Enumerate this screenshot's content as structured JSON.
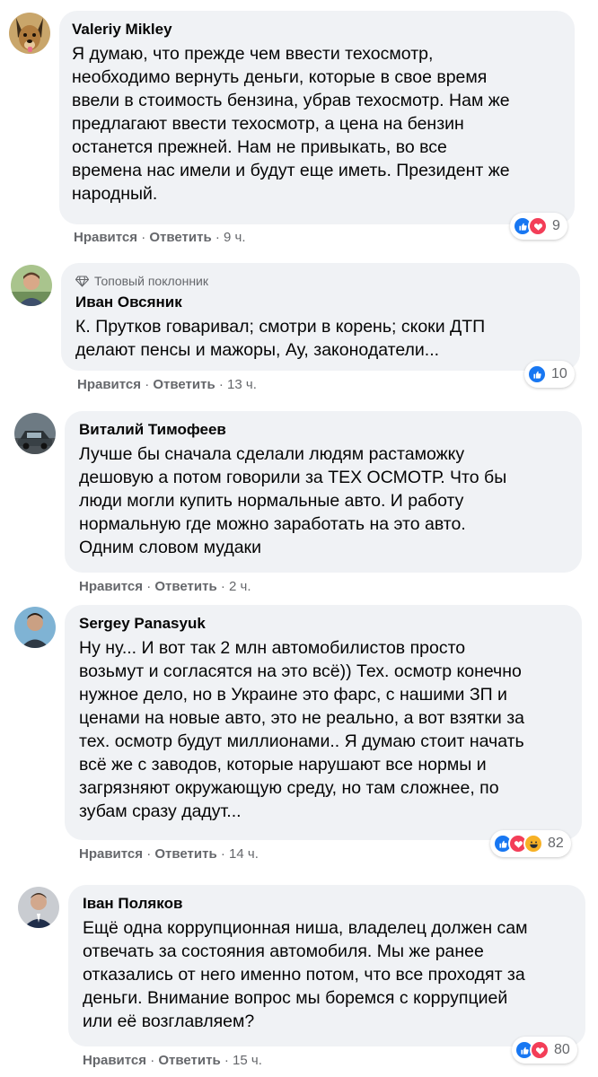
{
  "comments": [
    {
      "author": "Valeriy Mikley",
      "text": "Я думаю, что прежде чем ввести техосмотр,\nнеобходимо вернуть деньги, которые в свое время\nввели в стоимость бензина, убрав техосмотр. Нам же\nпредлагают ввести техосмотр, а цена на бензин\nостанется прежней. Нам не привыкать, во все\nвремена нас имели и будут еще иметь. Президент же\nнародный.",
      "like": "Нравится",
      "reply": "Ответить",
      "time": "9 ч.",
      "reaction_count": "9",
      "reaction_icons": [
        "like-reaction",
        "love-reaction"
      ]
    },
    {
      "badge": "Топовый поклонник",
      "badge_icon": "diamond-icon",
      "author": "Иван Овсяник",
      "text": "К. Прутков говаривал; смотри в корень; скоки ДТП\nделают пенсы и мажоры, Ау, законодатели...",
      "like": "Нравится",
      "reply": "Ответить",
      "time": "13 ч.",
      "reaction_count": "10",
      "reaction_icons": [
        "like-reaction"
      ]
    },
    {
      "author": "Виталий Тимофеев",
      "text": "Лучше бы сначала сделали людям растаможку\nдешовую а потом говорили за ТЕХ ОСМОТР. Что бы\nлюди могли купить нормальные авто. И работу\nнормальную где можно заработать на это авто.\nОдним словом мудаки",
      "like": "Нравится",
      "reply": "Ответить",
      "time": "2 ч."
    },
    {
      "author": "Sergey Panasyuk",
      "text": "Ну ну... И вот так 2 млн автомобилистов просто\nвозьмут и согласятся на это всё)) Тех. осмотр конечно\nнужное дело, но в Украине это фарс, с нашими ЗП и\nценами на новые авто, это не реально, а вот взятки за\nтех. осмотр будут миллионами.. Я думаю стоит начать\nвсё же с заводов, которые нарушают все нормы и\nзагрязняют окружающую среду, но там сложнее, по\nзубам сразу дадут...",
      "like": "Нравится",
      "reply": "Ответить",
      "time": "14 ч.",
      "reaction_count": "82",
      "reaction_icons": [
        "like-reaction",
        "love-reaction",
        "haha-reaction"
      ]
    },
    {
      "author": "Іван Поляков",
      "text": "Ещё одна коррупционная ниша, владелец должен сам\nотвечать за состояния автомобиля. Мы же ранее\nотказались от него именно потом, что все проходят за\nденьги. Внимание вопрос мы боремся с коррупцией\nили её возглавляем?",
      "like": "Нравится",
      "reply": "Ответить",
      "time": "15 ч.",
      "reaction_count": "80",
      "reaction_icons": [
        "like-reaction",
        "love-reaction"
      ]
    }
  ]
}
